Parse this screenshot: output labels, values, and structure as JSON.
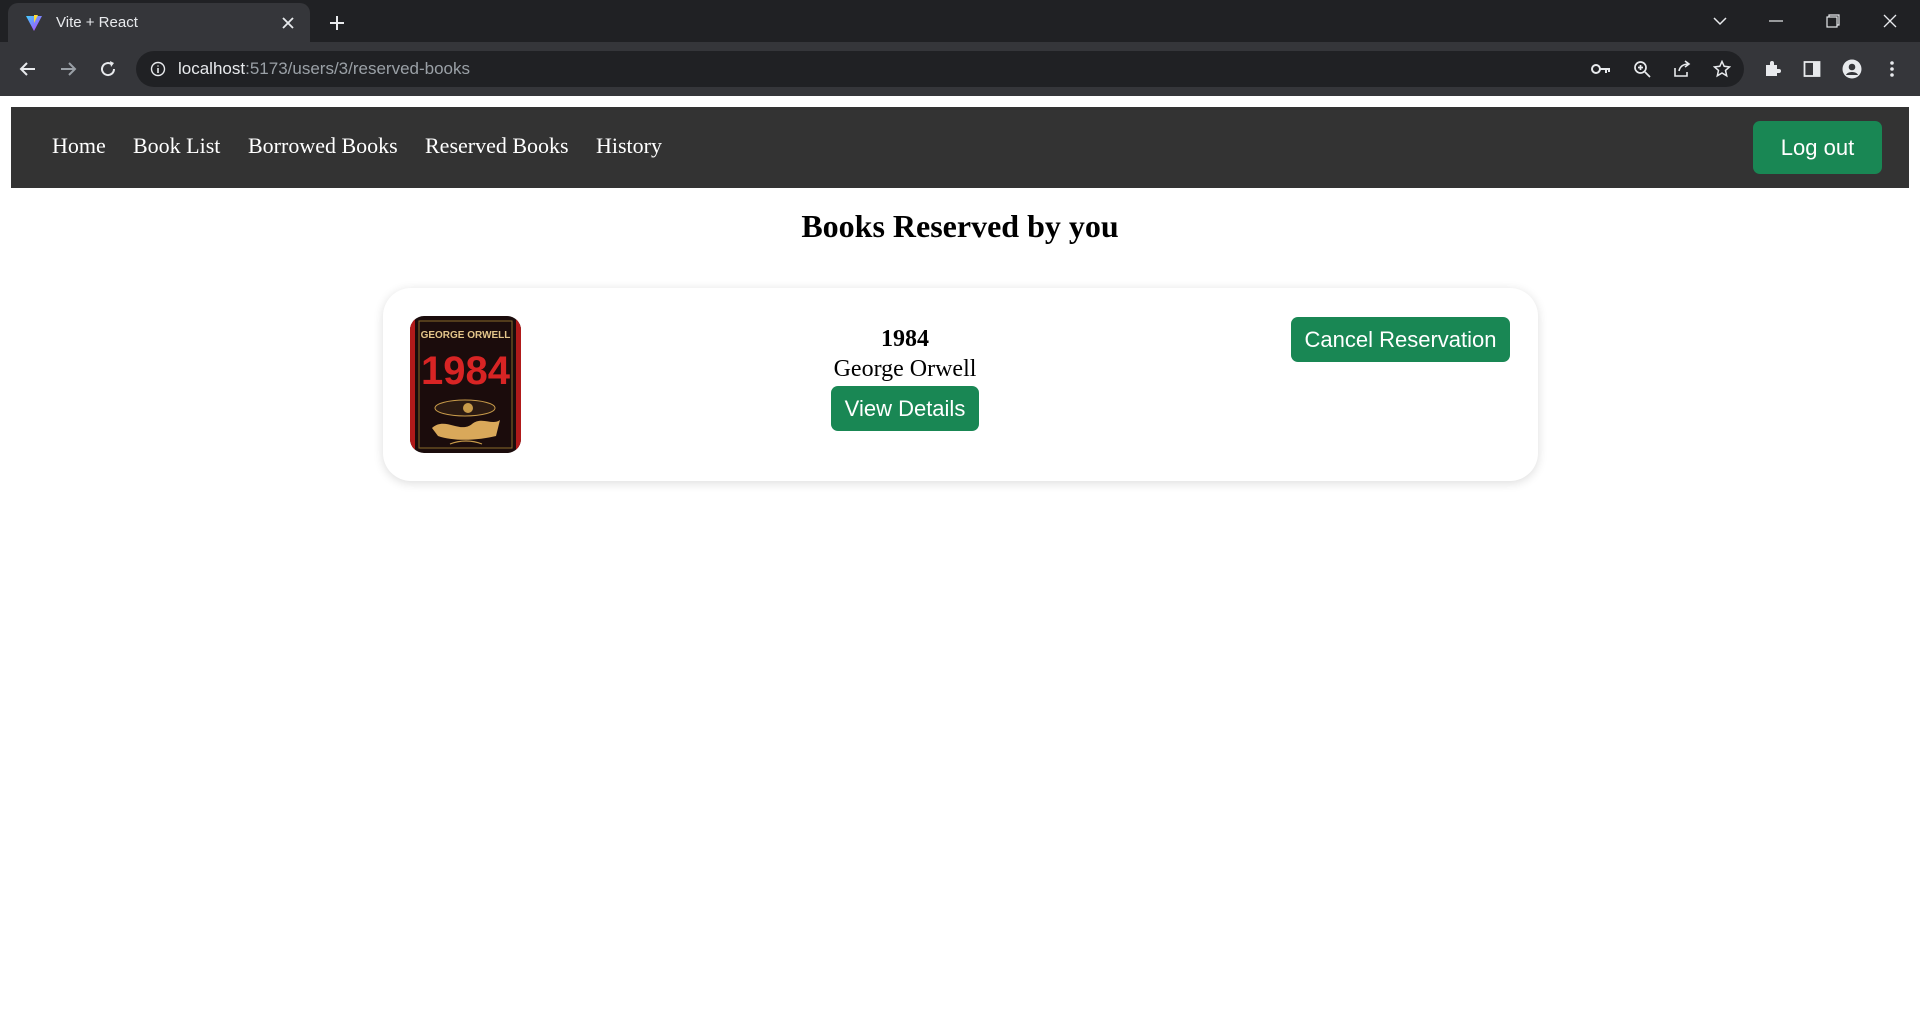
{
  "browser": {
    "tab_title": "Vite + React",
    "url_host": "localhost",
    "url_path": ":5173/users/3/reserved-books"
  },
  "nav": {
    "links": [
      "Home",
      "Book List",
      "Borrowed Books",
      "Reserved Books",
      "History"
    ],
    "logout_label": "Log out"
  },
  "page": {
    "title": "Books Reserved by you"
  },
  "reservations": [
    {
      "cover_text_author": "GEORGE ORWELL",
      "cover_text_title": "1984",
      "title": "1984",
      "author": "George Orwell",
      "view_label": "View Details",
      "cancel_label": "Cancel Reservation"
    }
  ],
  "colors": {
    "accent": "#198754",
    "navbar": "#333333",
    "chrome_dark": "#202124",
    "chrome_toolbar": "#35363a"
  }
}
